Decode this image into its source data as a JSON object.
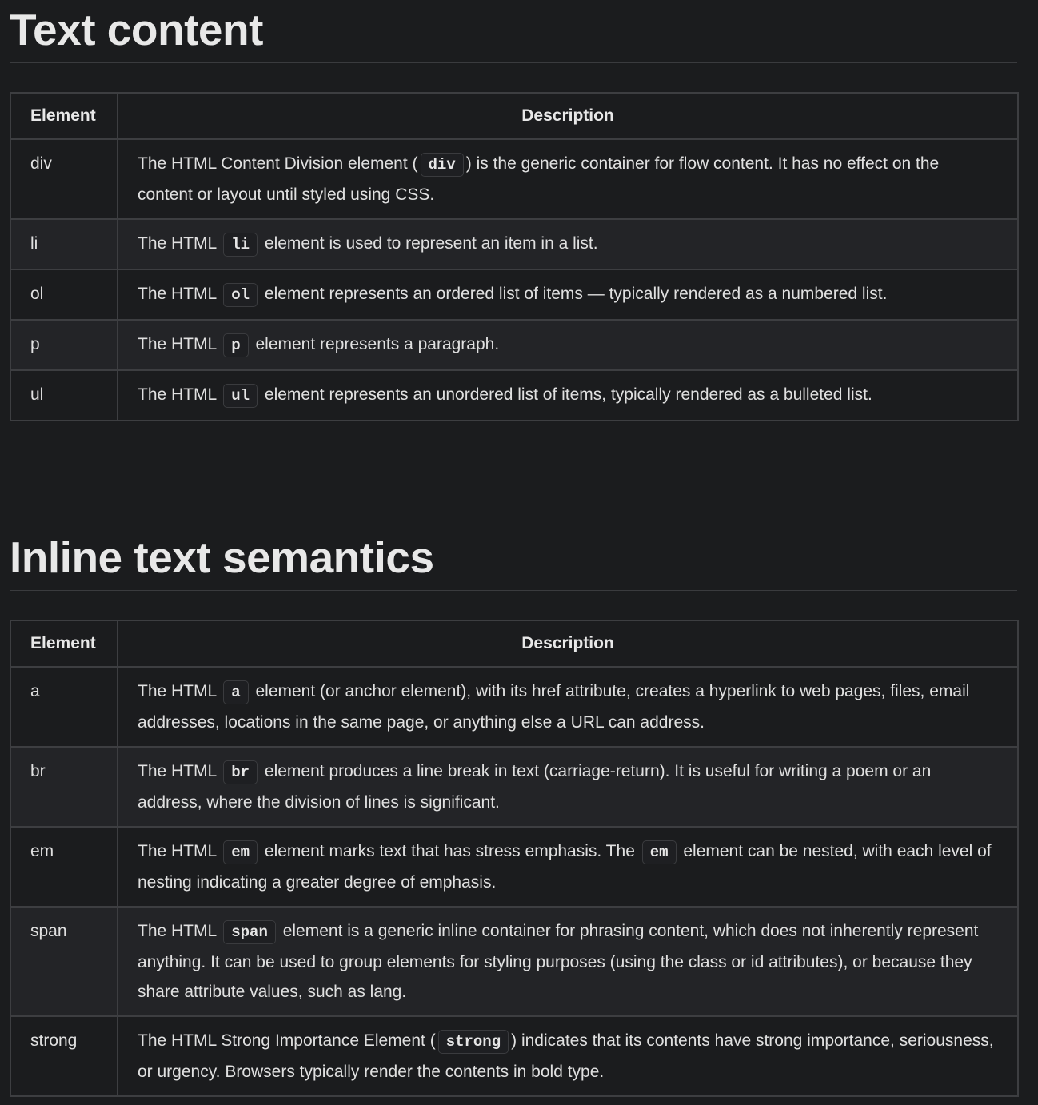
{
  "sections": [
    {
      "heading": "Text content",
      "header": {
        "element": "Element",
        "description": "Description"
      },
      "rows": [
        {
          "element": "div",
          "desc": [
            {
              "t": "The HTML Content Division element ("
            },
            {
              "c": "div"
            },
            {
              "t": ") is the generic container for flow content. It has no effect on the content or layout until styled using CSS."
            }
          ]
        },
        {
          "element": "li",
          "desc": [
            {
              "t": "The HTML "
            },
            {
              "c": "li"
            },
            {
              "t": " element is used to represent an item in a list."
            }
          ]
        },
        {
          "element": "ol",
          "desc": [
            {
              "t": "The HTML "
            },
            {
              "c": "ol"
            },
            {
              "t": " element represents an ordered list of items — typically rendered as a numbered list."
            }
          ]
        },
        {
          "element": "p",
          "desc": [
            {
              "t": "The HTML "
            },
            {
              "c": "p"
            },
            {
              "t": " element represents a paragraph."
            }
          ]
        },
        {
          "element": "ul",
          "desc": [
            {
              "t": "The HTML "
            },
            {
              "c": "ul"
            },
            {
              "t": " element represents an unordered list of items, typically rendered as a bulleted list."
            }
          ]
        }
      ]
    },
    {
      "heading": "Inline text semantics",
      "header": {
        "element": "Element",
        "description": "Description"
      },
      "rows": [
        {
          "element": "a",
          "desc": [
            {
              "t": "The HTML "
            },
            {
              "c": "a"
            },
            {
              "t": " element (or anchor element), with its href attribute, creates a hyperlink to web pages, files, email addresses, locations in the same page, or anything else a URL can address."
            }
          ]
        },
        {
          "element": "br",
          "desc": [
            {
              "t": "The HTML "
            },
            {
              "c": "br"
            },
            {
              "t": " element produces a line break in text (carriage-return). It is useful for writing a poem or an address, where the division of lines is significant."
            }
          ]
        },
        {
          "element": "em",
          "desc": [
            {
              "t": "The HTML "
            },
            {
              "c": "em"
            },
            {
              "t": " element marks text that has stress emphasis. The "
            },
            {
              "c": "em"
            },
            {
              "t": " element can be nested, with each level of nesting indicating a greater degree of emphasis."
            }
          ]
        },
        {
          "element": "span",
          "desc": [
            {
              "t": "The HTML "
            },
            {
              "c": "span"
            },
            {
              "t": " element is a generic inline container for phrasing content, which does not inherently represent anything. It can be used to group elements for styling purposes (using the class or id attributes), or because they share attribute values, such as lang."
            }
          ]
        },
        {
          "element": "strong",
          "desc": [
            {
              "t": "The HTML Strong Importance Element ("
            },
            {
              "c": "strong"
            },
            {
              "t": ") indicates that its contents have strong importance, seriousness, or urgency. Browsers typically render the contents in bold type."
            }
          ]
        }
      ]
    }
  ]
}
